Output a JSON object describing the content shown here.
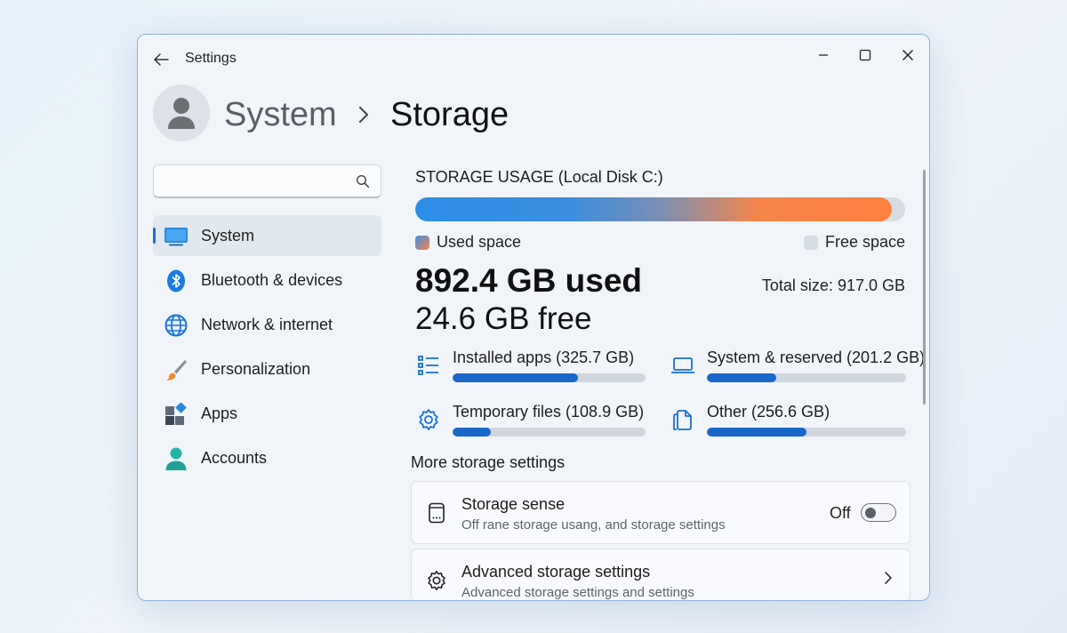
{
  "window": {
    "app_title": "Settings"
  },
  "header": {
    "breadcrumb_parent": "System",
    "breadcrumb_current": "Storage"
  },
  "search": {
    "placeholder": ""
  },
  "sidebar": {
    "items": [
      {
        "label": "System",
        "icon": "monitor-icon",
        "active": true
      },
      {
        "label": "Bluetooth & devices",
        "icon": "bluetooth-icon"
      },
      {
        "label": "Network & internet",
        "icon": "globe-icon"
      },
      {
        "label": "Personalization",
        "icon": "paintbrush-icon"
      },
      {
        "label": "Apps",
        "icon": "apps-icon"
      },
      {
        "label": "Accounts",
        "icon": "person-icon"
      }
    ]
  },
  "storage": {
    "title": "STORAGE USAGE (Local Disk C:)",
    "used_fraction": 0.973,
    "legend_used": "Used space",
    "legend_free": "Free space",
    "used_text": "892.4 GB used",
    "free_text": "24.6 GB free",
    "total_text": "Total size: 917.0 GB",
    "colors": {
      "accent": "#1967c6",
      "used_start": "#2c8ee6",
      "used_end": "#ff8140"
    },
    "categories": [
      {
        "label": "Installed apps (325.7 GB)",
        "icon": "list-icon",
        "fraction": 0.65
      },
      {
        "label": "System & reserved (201.2 GB)",
        "icon": "laptop-icon",
        "fraction": 0.35
      },
      {
        "label": "Temporary files (108.9 GB)",
        "icon": "gear-icon",
        "fraction": 0.2
      },
      {
        "label": "Other (256.6 GB)",
        "icon": "files-icon",
        "fraction": 0.5
      }
    ]
  },
  "more_settings": {
    "title": "More storage settings",
    "storage_sense": {
      "title": "Storage sense",
      "subtitle": "Off rane storage usang, and storage settings",
      "state_label": "Off",
      "on": false
    },
    "advanced": {
      "title": "Advanced storage settings",
      "subtitle": "Advanced storage settings and settings"
    }
  }
}
